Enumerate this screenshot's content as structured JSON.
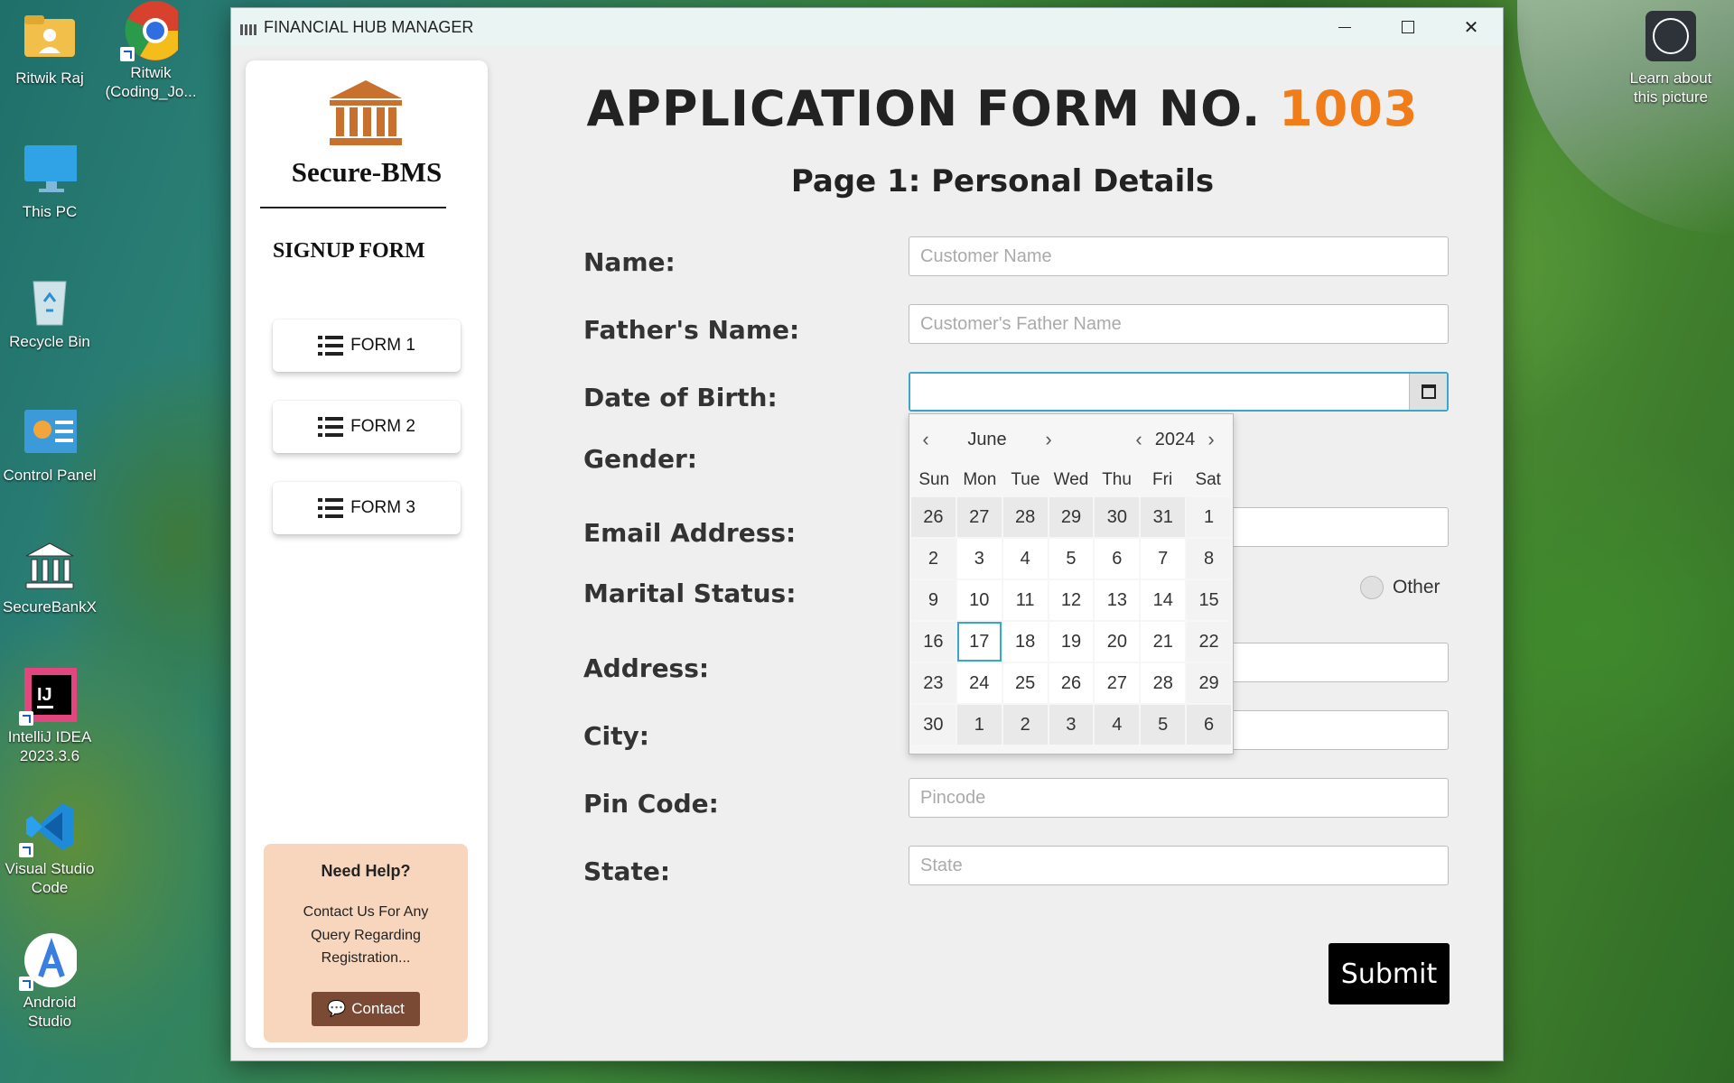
{
  "desktop": {
    "icons": [
      {
        "label": "Ritwik Raj"
      },
      {
        "label": "Ritwik (Coding_Jo..."
      },
      {
        "label": "This PC"
      },
      {
        "label": "Recycle Bin"
      },
      {
        "label": "Control Panel"
      },
      {
        "label": "SecureBankX"
      },
      {
        "label": "IntelliJ IDEA 2023.3.6"
      },
      {
        "label": "Visual Studio Code"
      },
      {
        "label": "Android Studio"
      }
    ],
    "learn_label": "Learn about this picture"
  },
  "window": {
    "title": "FINANCIAL HUB MANAGER",
    "controls": {
      "minimize": "",
      "maximize": "",
      "close": "✕"
    }
  },
  "sidebar": {
    "brand": "Secure-BMS",
    "section_title": "SIGNUP FORM",
    "forms": [
      {
        "label": "FORM 1"
      },
      {
        "label": "FORM 2"
      },
      {
        "label": "FORM 3"
      }
    ],
    "help": {
      "title": "Need Help?",
      "text": "Contact Us For Any Query Regarding Registration...",
      "button_label": "Contact"
    }
  },
  "main": {
    "heading_prefix": "APPLICATION FORM NO.",
    "form_number": "1003",
    "subheading": "Page 1: Personal Details",
    "fields": {
      "name": {
        "label": "Name:",
        "placeholder": "Customer Name",
        "value": ""
      },
      "father": {
        "label": "Father's Name:",
        "placeholder": "Customer's Father Name",
        "value": ""
      },
      "dob": {
        "label": "Date of Birth:",
        "value": ""
      },
      "gender": {
        "label": "Gender:"
      },
      "email": {
        "label": "Email Address:"
      },
      "marital": {
        "label": "Marital Status:",
        "other_option": "Other"
      },
      "address": {
        "label": "Address:"
      },
      "city": {
        "label": "City:"
      },
      "pincode": {
        "label": "Pin Code:",
        "placeholder": "Pincode"
      },
      "state": {
        "label": "State:",
        "placeholder": "State"
      }
    },
    "submit_label": "Submit"
  },
  "date_picker": {
    "month": "June",
    "year": "2024",
    "weekdays": [
      "Sun",
      "Mon",
      "Tue",
      "Wed",
      "Thu",
      "Fri",
      "Sat"
    ],
    "selected_day": "17",
    "weeks": [
      [
        "26",
        "27",
        "28",
        "29",
        "30",
        "31",
        "1"
      ],
      [
        "2",
        "3",
        "4",
        "5",
        "6",
        "7",
        "8"
      ],
      [
        "9",
        "10",
        "11",
        "12",
        "13",
        "14",
        "15"
      ],
      [
        "16",
        "17",
        "18",
        "19",
        "20",
        "21",
        "22"
      ],
      [
        "23",
        "24",
        "25",
        "26",
        "27",
        "28",
        "29"
      ],
      [
        "30",
        "1",
        "2",
        "3",
        "4",
        "5",
        "6"
      ]
    ],
    "muted_cells": [
      [
        0,
        0
      ],
      [
        0,
        1
      ],
      [
        0,
        2
      ],
      [
        0,
        3
      ],
      [
        0,
        4
      ],
      [
        0,
        5
      ],
      [
        5,
        1
      ],
      [
        5,
        2
      ],
      [
        5,
        3
      ],
      [
        5,
        4
      ],
      [
        5,
        5
      ],
      [
        5,
        6
      ]
    ]
  },
  "colors": {
    "accent_orange": "#f07d1a",
    "focus_blue": "#3aa7c7",
    "help_bg": "#f8d6bd",
    "contact_btn": "#7a4a34",
    "logo": "#c8702e"
  }
}
